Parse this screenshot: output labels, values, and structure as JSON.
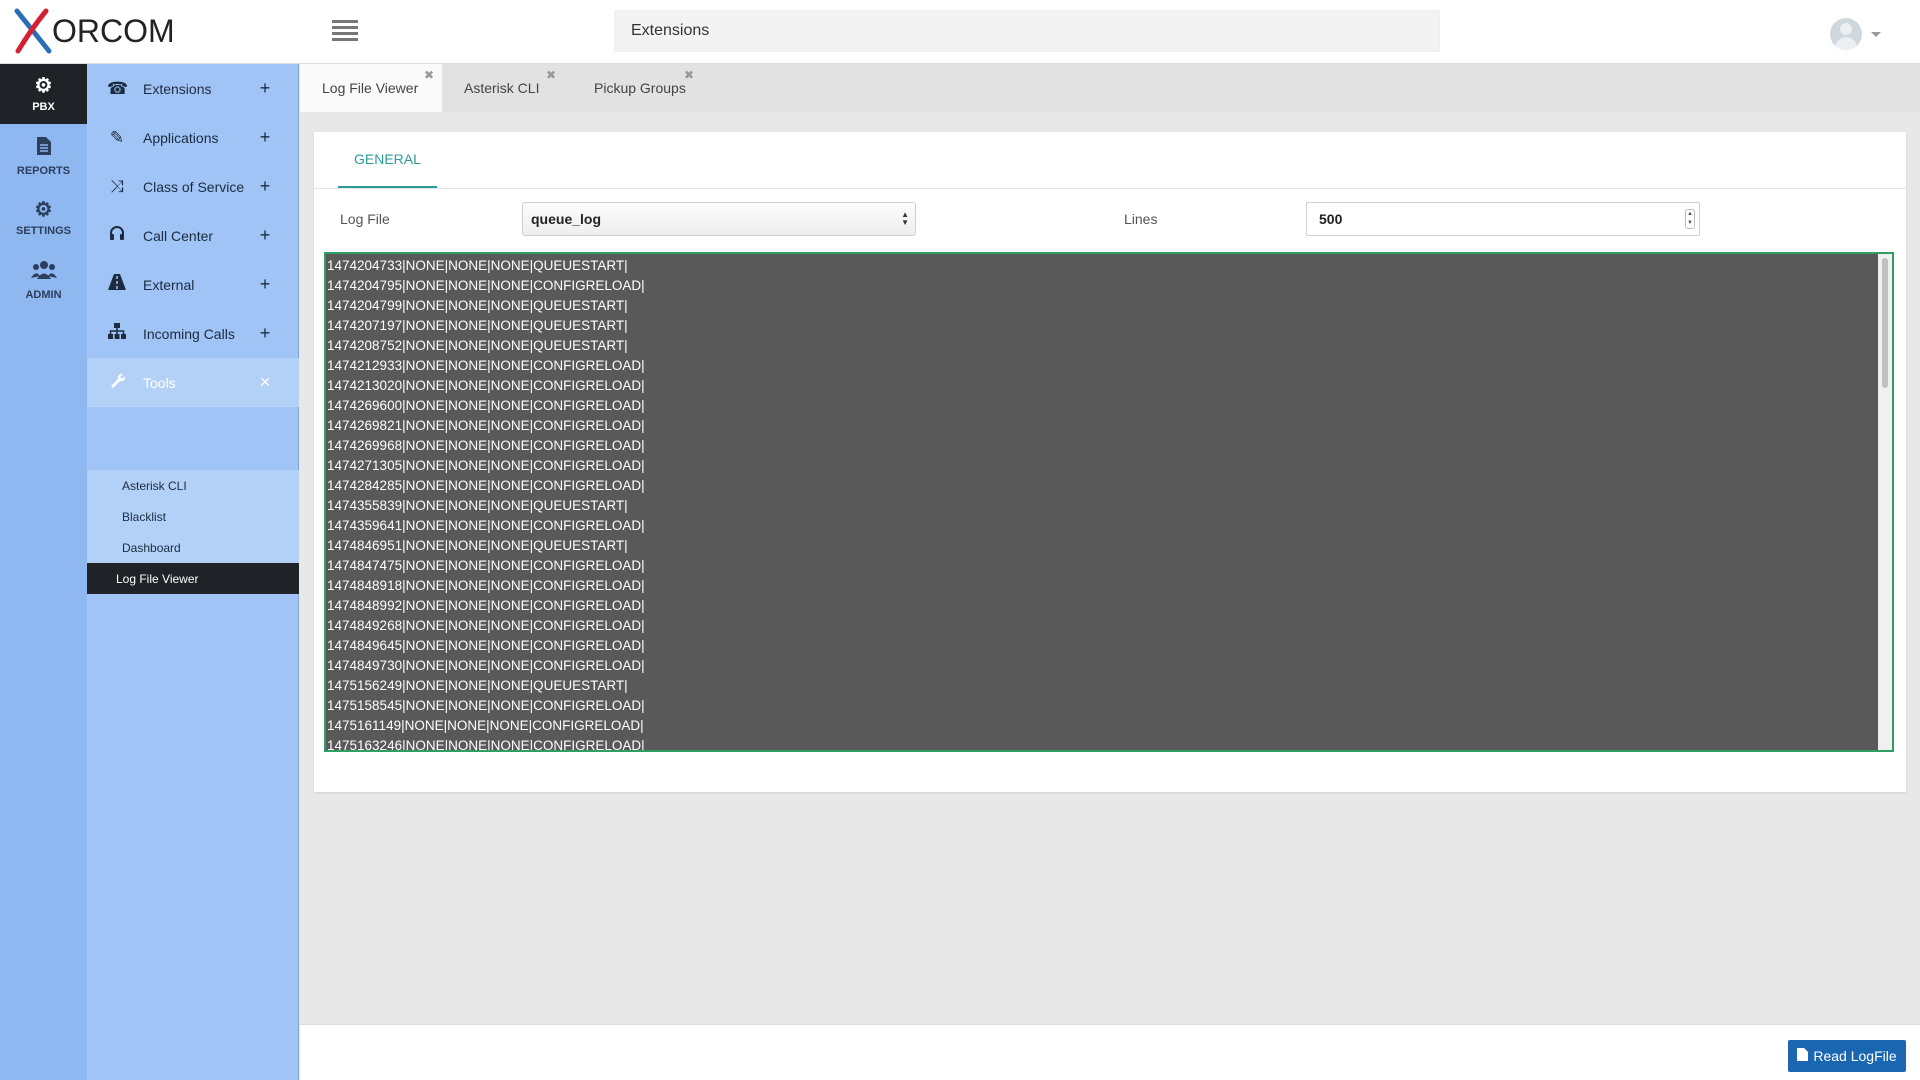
{
  "brand": {
    "name": "ORCOM",
    "accent_color": "#d51f32",
    "x_color": "#2a6fb4"
  },
  "header": {
    "search_value": "Extensions",
    "menu_icon": "list-icon",
    "avatar_icon": "user-avatar"
  },
  "rail": {
    "items": [
      {
        "label": "PBX",
        "icon": "gear-icon",
        "active": true
      },
      {
        "label": "REPORTS",
        "icon": "file-icon"
      },
      {
        "label": "SETTINGS",
        "icon": "gears-icon"
      },
      {
        "label": "ADMIN",
        "icon": "users-icon"
      }
    ]
  },
  "sidebar": {
    "items": [
      {
        "label": "Extensions",
        "icon": "phone-icon",
        "toggle": "+"
      },
      {
        "label": "Applications",
        "icon": "edit-icon",
        "toggle": "+"
      },
      {
        "label": "Class of Service",
        "icon": "shuffle-icon",
        "toggle": "+"
      },
      {
        "label": "Call Center",
        "icon": "headset-icon",
        "toggle": "+"
      },
      {
        "label": "External",
        "icon": "road-icon",
        "toggle": "+"
      },
      {
        "label": "Incoming Calls",
        "icon": "sitemap-icon",
        "toggle": "+"
      },
      {
        "label": "Tools",
        "icon": "wrench-icon",
        "toggle": "×"
      }
    ],
    "tools_sub": [
      {
        "label": "Asterisk CLI"
      },
      {
        "label": "Blacklist"
      },
      {
        "label": "Dashboard"
      },
      {
        "label": "Log File Viewer",
        "active": true
      }
    ]
  },
  "tabs": [
    {
      "label": "Log File Viewer",
      "active": true,
      "close": "✖"
    },
    {
      "label": "Asterisk CLI",
      "close": "✖"
    },
    {
      "label": "Pickup Groups",
      "close": "✖"
    }
  ],
  "panel": {
    "tab": "GENERAL",
    "log_file_label": "Log File",
    "log_file_value": "queue_log",
    "lines_label": "Lines",
    "lines_value": "500",
    "log_lines": [
      "1474204733|NONE|NONE|NONE|QUEUESTART|",
      "1474204795|NONE|NONE|NONE|CONFIGRELOAD|",
      "1474204799|NONE|NONE|NONE|QUEUESTART|",
      "1474207197|NONE|NONE|NONE|QUEUESTART|",
      "1474208752|NONE|NONE|NONE|QUEUESTART|",
      "1474212933|NONE|NONE|NONE|CONFIGRELOAD|",
      "1474213020|NONE|NONE|NONE|CONFIGRELOAD|",
      "1474269600|NONE|NONE|NONE|CONFIGRELOAD|",
      "1474269821|NONE|NONE|NONE|CONFIGRELOAD|",
      "1474269968|NONE|NONE|NONE|CONFIGRELOAD|",
      "1474271305|NONE|NONE|NONE|CONFIGRELOAD|",
      "1474284285|NONE|NONE|NONE|CONFIGRELOAD|",
      "1474355839|NONE|NONE|NONE|QUEUESTART|",
      "1474359641|NONE|NONE|NONE|CONFIGRELOAD|",
      "1474846951|NONE|NONE|NONE|QUEUESTART|",
      "1474847475|NONE|NONE|NONE|CONFIGRELOAD|",
      "1474848918|NONE|NONE|NONE|CONFIGRELOAD|",
      "1474848992|NONE|NONE|NONE|CONFIGRELOAD|",
      "1474849268|NONE|NONE|NONE|CONFIGRELOAD|",
      "1474849645|NONE|NONE|NONE|CONFIGRELOAD|",
      "1474849730|NONE|NONE|NONE|CONFIGRELOAD|",
      "1475156249|NONE|NONE|NONE|QUEUESTART|",
      "1475158545|NONE|NONE|NONE|CONFIGRELOAD|",
      "1475161149|NONE|NONE|NONE|CONFIGRELOAD|",
      "1475163246|NONE|NONE|NONE|CONFIGRELOAD|"
    ]
  },
  "footer": {
    "read_button": "Read LogFile",
    "read_icon": "file-icon",
    "button_color": "#1a66b0"
  }
}
